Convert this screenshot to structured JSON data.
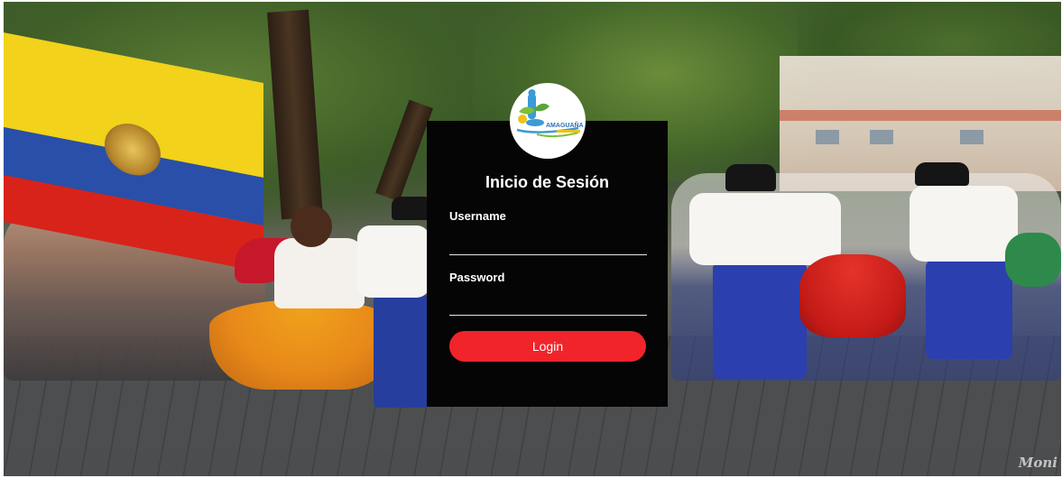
{
  "logo": {
    "text": "AMAGUAÑA",
    "colors": {
      "blue": "#3a9bd6",
      "green": "#7fbf3a",
      "yellow": "#f1c21a"
    }
  },
  "login": {
    "title": "Inicio de Sesión",
    "username_label": "Username",
    "username_value": "",
    "password_label": "Password",
    "password_value": "",
    "button_label": "Login"
  },
  "background": {
    "signature": "Moni"
  },
  "colors": {
    "panel": "#050505",
    "button": "#f0242a",
    "text": "#ffffff"
  }
}
